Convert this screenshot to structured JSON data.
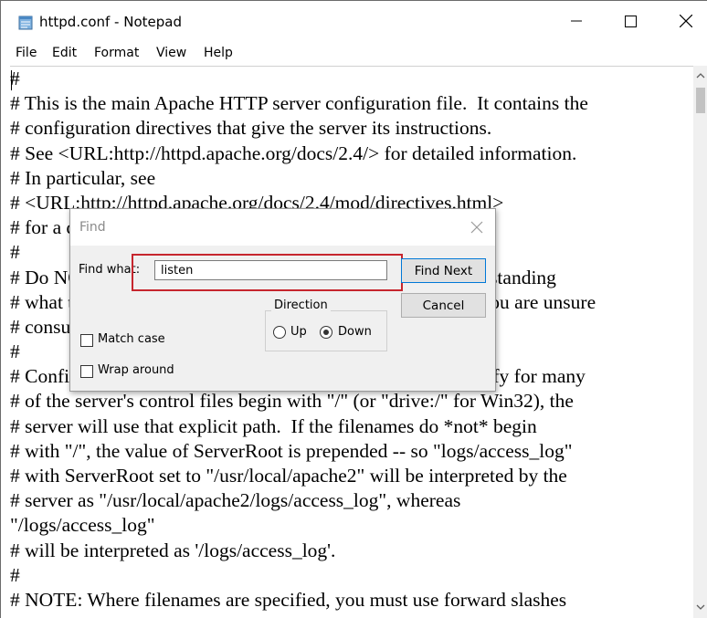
{
  "window": {
    "title": "httpd.conf - Notepad",
    "minimize_icon": "minimize-icon",
    "maximize_icon": "maximize-icon",
    "close_icon": "close-icon"
  },
  "menu": [
    "File",
    "Edit",
    "Format",
    "View",
    "Help"
  ],
  "editor_lines": [
    "#",
    "# This is the main Apache HTTP server configuration file.  It contains the",
    "# configuration directives that give the server its instructions.",
    "# See <URL:http://httpd.apache.org/docs/2.4/> for detailed information.",
    "# In particular, see",
    "# <URL:http://httpd.apache.org/docs/2.4/mod/directives.html>",
    "# for a discussion of each configuration directive.",
    "#",
    "# Do NOT simply read the instructions in here without understanding",
    "# what they do.  They're here only as hints or reminders.  If you are unsure",
    "# consult the online docs. You have been warned.",
    "#",
    "# Configuration and logfile names: If the filenames you specify for many",
    "# of the server's control files begin with \"/\" (or \"drive:/\" for Win32), the",
    "# server will use that explicit path.  If the filenames do *not* begin",
    "# with \"/\", the value of ServerRoot is prepended -- so \"logs/access_log\"",
    "# with ServerRoot set to \"/usr/local/apache2\" will be interpreted by the",
    "# server as \"/usr/local/apache2/logs/access_log\", whereas",
    "\"/logs/access_log\"",
    "# will be interpreted as '/logs/access_log'.",
    "#",
    "# NOTE: Where filenames are specified, you must use forward slashes"
  ],
  "find_dialog": {
    "title": "Find",
    "find_what_label": "Find what:",
    "find_what_value": "listen",
    "find_next_label": "Find Next",
    "cancel_label": "Cancel",
    "direction_label": "Direction",
    "up_label": "Up",
    "down_label": "Down",
    "direction_selected": "Down",
    "match_case_label": "Match case",
    "match_case_checked": false,
    "wrap_around_label": "Wrap around",
    "wrap_around_checked": false
  },
  "colors": {
    "highlight": "#c6262e",
    "dialog_bg": "#f0f0f0"
  }
}
